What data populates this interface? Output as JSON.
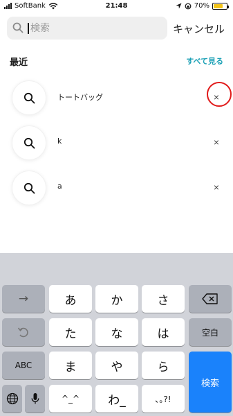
{
  "status": {
    "carrier": "SoftBank",
    "time": "21:48",
    "battery": "70%",
    "battery_level": 0.7
  },
  "search": {
    "placeholder": "検索",
    "value": "",
    "cancel_label": "キャンセル"
  },
  "recent": {
    "title": "最近",
    "see_all": "すべて見る",
    "items": [
      {
        "label": "トートバッグ"
      },
      {
        "label": "k"
      },
      {
        "label": "a"
      }
    ],
    "remove_label": "×"
  },
  "keyboard": {
    "row1": [
      "→",
      "あ",
      "か",
      "さ"
    ],
    "row2": [
      "た",
      "な",
      "は",
      "空白"
    ],
    "row3": [
      "ABC",
      "ま",
      "や",
      "ら",
      "検索"
    ],
    "row4": [
      "^_^",
      "わ_",
      "､｡?!"
    ],
    "colors": {
      "background": "#d1d3d9",
      "key": "#ffffff",
      "function_key": "#acb0b9",
      "action_key": "#1a82fb"
    }
  },
  "colors": {
    "accent": "#1aa0b5",
    "highlight": "#e11a1a"
  }
}
